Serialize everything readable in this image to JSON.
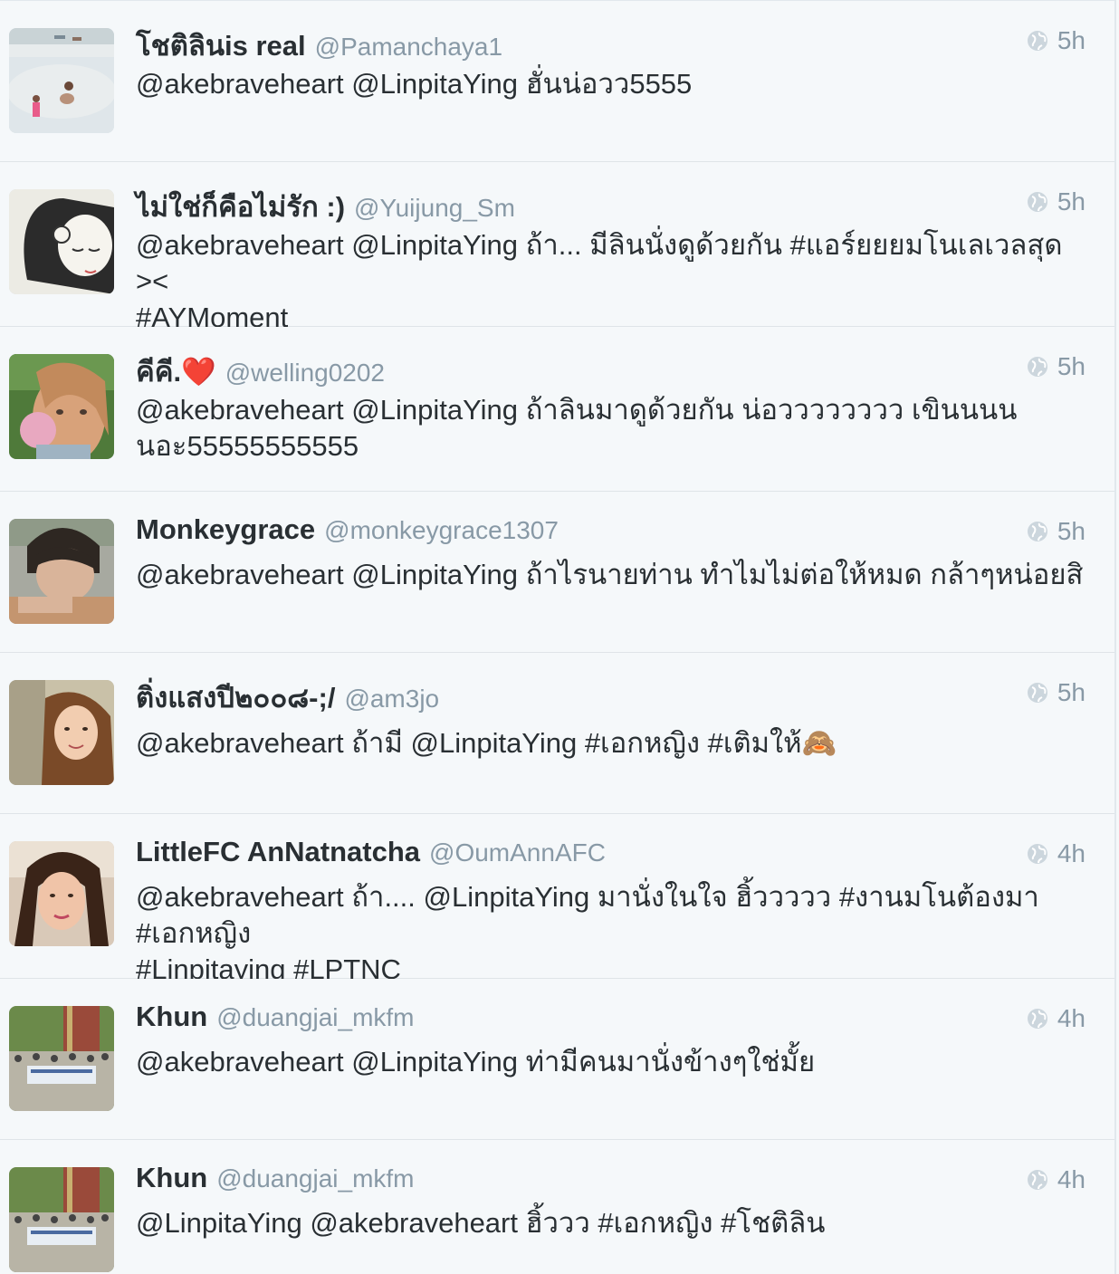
{
  "tweets": [
    {
      "name": "โชติลินis real",
      "handle": "@Pamanchaya1",
      "time": "5h",
      "text": "@akebraveheart @LinpitaYing ฮั่นน่อวว5555",
      "avatar": "beach-photo"
    },
    {
      "name": "ไม่ใช่ก็คือไม่รัก :)",
      "handle": "@Yuijung_Sm",
      "time": "5h",
      "text": "@akebraveheart @LinpitaYing ถ้า... มีลินนั่งดูด้วยกัน #แอร์ยยยมโนเลเวลสุด ><\n#AYMoment",
      "avatar": "sketch-girl"
    },
    {
      "name": "คีคี.❤️",
      "handle": "@welling0202",
      "time": "5h",
      "text": "@akebraveheart @LinpitaYing ถ้าลินมาดูด้วยกัน น่อวววววววว เขินนนน\nนอะ55555555555",
      "avatar": "child-icecream"
    },
    {
      "name": "Monkeygrace",
      "handle": "@monkeygrace1307",
      "time": "5h",
      "text": "@akebraveheart @LinpitaYing ถ้าไรนายท่าน ทำไมไม่ต่อให้หมด กล้าๆหน่อยสิ",
      "avatar": "boy-portrait"
    },
    {
      "name": "ติ่งแสงปี๒๐๐๘-;/",
      "handle": "@am3jo",
      "time": "5h",
      "text": "@akebraveheart ถ้ามี @LinpitaYing #เอกหญิง #เติมให้🙈",
      "avatar": "woman-portrait"
    },
    {
      "name": "LittleFC AnNatnatcha",
      "handle": "@OumAnnAFC",
      "time": "4h",
      "text": "@akebraveheart ถ้า.... @LinpitaYing มานั่งในใจ ฮิ้ววววว #งานมโนต้องมา #เอกหญิง\n#Linpitaying #LPTNC",
      "avatar": "selfie-girl"
    },
    {
      "name": "Khun",
      "handle": "@duangjai_mkfm",
      "time": "4h",
      "text": "@akebraveheart @LinpitaYing ท่ามีคนมานั่งข้างๆใช่มั้ย",
      "avatar": "group-photo"
    },
    {
      "name": "Khun",
      "handle": "@duangjai_mkfm",
      "time": "4h",
      "text": "@LinpitaYing @akebraveheart ฮิ้ววว #เอกหญิง #โชติลิน",
      "avatar": "group-photo"
    }
  ],
  "colors": {
    "name": "#292f33",
    "meta": "#8899a6",
    "background": "#f5f8fa",
    "divider": "#dfe4e8"
  },
  "icons": {
    "timestamp": "globe-icon"
  }
}
